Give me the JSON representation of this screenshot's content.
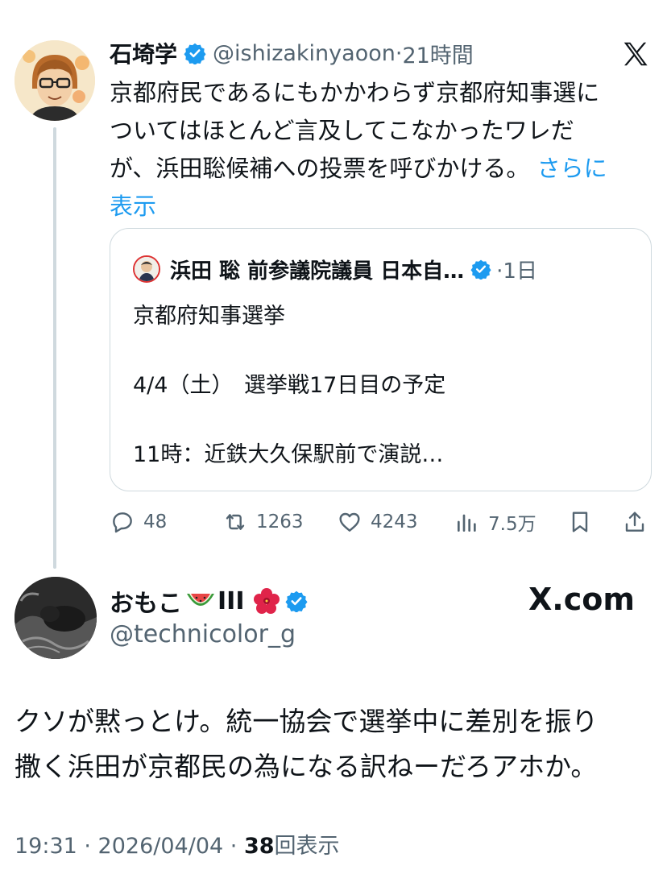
{
  "quoted_tweet": {
    "name": "石埼学",
    "handle": "@ishizakinyaoon",
    "sep": "·",
    "time": "21時間",
    "lines": [
      "京都府民であるにもかかわらず京都府知事選に",
      "ついてはほとんど言及してこなかったワレだ",
      "が、浜田聡候補への投票を呼びかける。"
    ],
    "more_a": "さらに",
    "more_b": "表示",
    "embedded": {
      "name": "浜田 聡 前参議院議員 日本自…",
      "time": "·1日",
      "line1": "京都府知事選挙",
      "line2": "4/4（土）　選挙戦17日目の予定",
      "line3": "11時：近鉄大久保駅前で演説…"
    },
    "actions": {
      "replies": "48",
      "retweets": "1263",
      "likes": "4243",
      "views": "7.5万"
    }
  },
  "reply": {
    "name": "おもこ",
    "name_suffix": "III",
    "handle": "@technicolor_g",
    "brand": "X.com",
    "text_line1": "クソが黙っとけ。統一協会で選挙中に差別を振り",
    "text_line2": "撒く浜田が京都民の為になる訳ねーだろアホか。",
    "footer_time": "19:31 · 2026/04/04 · ",
    "footer_views": "38",
    "footer_views_label": "回表示"
  },
  "colors": {
    "link": "#1d9bf0",
    "verified": "#1d9bf0",
    "muted": "#536471",
    "border": "#cfd9de"
  },
  "icons": [
    "verified-icon",
    "x-logo-icon",
    "reply-icon",
    "retweet-icon",
    "like-icon",
    "views-icon",
    "bookmark-icon",
    "share-icon",
    "watermelon-emoji",
    "hibiscus-emoji"
  ]
}
